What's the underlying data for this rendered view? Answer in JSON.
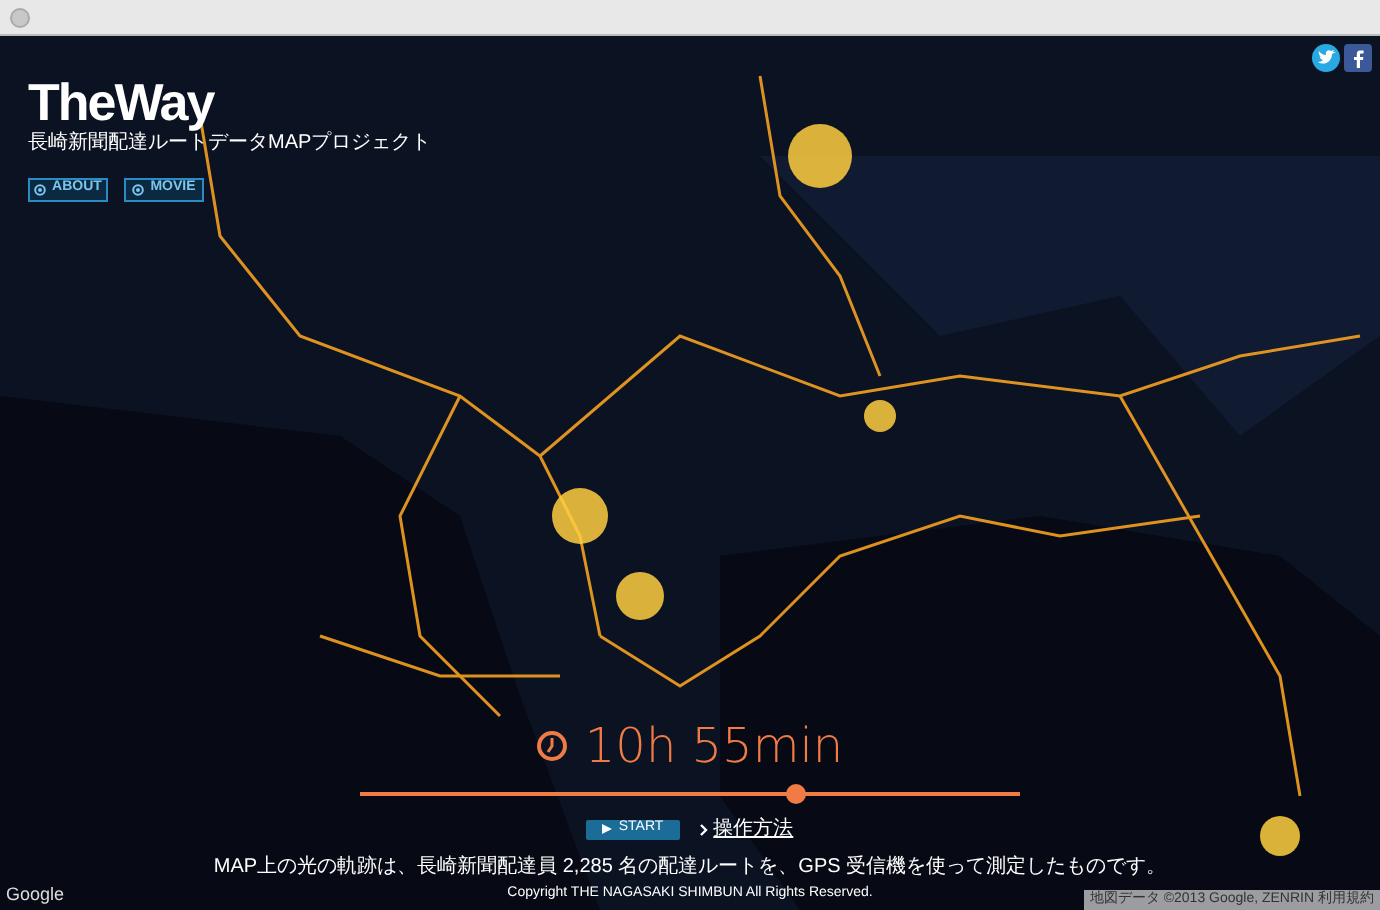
{
  "logo": {
    "title": "TheWay",
    "subtitle": "長崎新聞配達ルートデータMAPプロジェクト"
  },
  "nav": [
    {
      "label": "ABOUT"
    },
    {
      "label": "MOVIE"
    }
  ],
  "social": [
    {
      "kind": "twitter"
    },
    {
      "kind": "facebook"
    }
  ],
  "timer": {
    "text": "10h 55min"
  },
  "slider": {
    "level": 0.66
  },
  "start_button": "START",
  "help_link": "操作方法",
  "footer": {
    "note": "MAP上の光の軌跡は、長崎新聞配達員 2,285 名の配達ルートを、GPS 受信機を使って測定したものです。",
    "copyright": "Copyright THE NAGASAKI SHIMBUN All Rights Reserved."
  },
  "map": {
    "provider": "Google",
    "attribution": "地図データ ©2013 Google, ZENRIN 利用規約"
  }
}
